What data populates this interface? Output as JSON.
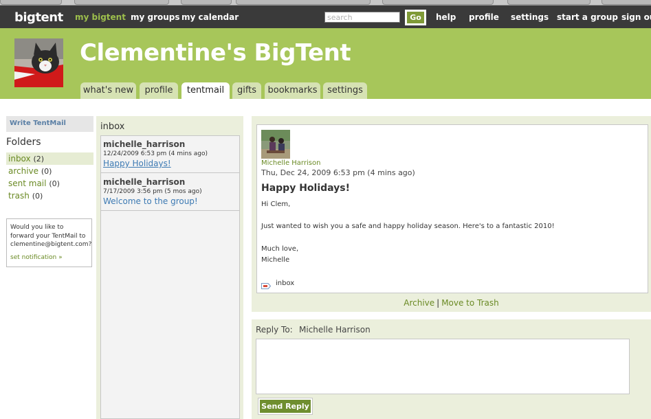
{
  "topnav": {
    "logo": "bigtent",
    "links": {
      "my_bigtent": "my bigtent",
      "my_groups": "my groups",
      "my_calendar": "my calendar",
      "help": "help",
      "profile": "profile",
      "settings": "settings",
      "start_group": "start a group",
      "sign_out": "sign out"
    },
    "search_placeholder": "search",
    "go_label": "Go"
  },
  "header": {
    "title": "Clementine's BigTent",
    "tabs": {
      "whats_new": "what's new",
      "profile": "profile",
      "tentmail": "tentmail",
      "gifts": "gifts",
      "bookmarks": "bookmarks",
      "settings": "settings"
    }
  },
  "sidebar": {
    "write_label": "Write TentMail",
    "folders_heading": "Folders",
    "folders": [
      {
        "label": "inbox",
        "count": "(2)"
      },
      {
        "label": "archive",
        "count": "(0)"
      },
      {
        "label": "sent mail",
        "count": "(0)"
      },
      {
        "label": "trash",
        "count": "(0)"
      }
    ],
    "forward_text": "Would you like to forward your TentMail to clementine@bigtent.com?",
    "set_notification": "set notification »"
  },
  "inbox": {
    "heading": "inbox",
    "messages": [
      {
        "from": "michelle_harrison",
        "date": "12/24/2009 6:53 pm (4 mins ago)",
        "subject": "Happy Holidays!"
      },
      {
        "from": "michelle_harrison",
        "date": "7/17/2009 3:56 pm (5 mos ago)",
        "subject": "Welcome to the group!"
      }
    ]
  },
  "message": {
    "sender": "Michelle Harrison",
    "date": "Thu, Dec 24, 2009 6:53 pm (4 mins ago)",
    "subject": "Happy Holidays!",
    "body": {
      "greeting": "Hi Clem,",
      "line1": "Just wanted to wish you a safe and happy holiday season. Here's to a fantastic 2010!",
      "closing": "Much love,",
      "signature": "Michelle"
    },
    "tag": "inbox",
    "actions": {
      "archive": "Archive",
      "separator": "|",
      "trash": "Move to Trash"
    }
  },
  "reply": {
    "label": "Reply To:",
    "to_name": "Michelle Harrison",
    "send_label": "Send Reply"
  },
  "colors": {
    "nav_bg": "#3a3a3a",
    "header_green": "#a7c65a",
    "accent_green": "#6a8a24",
    "link_blue": "#3d7ab3",
    "panel_bg": "#ebefdc"
  }
}
